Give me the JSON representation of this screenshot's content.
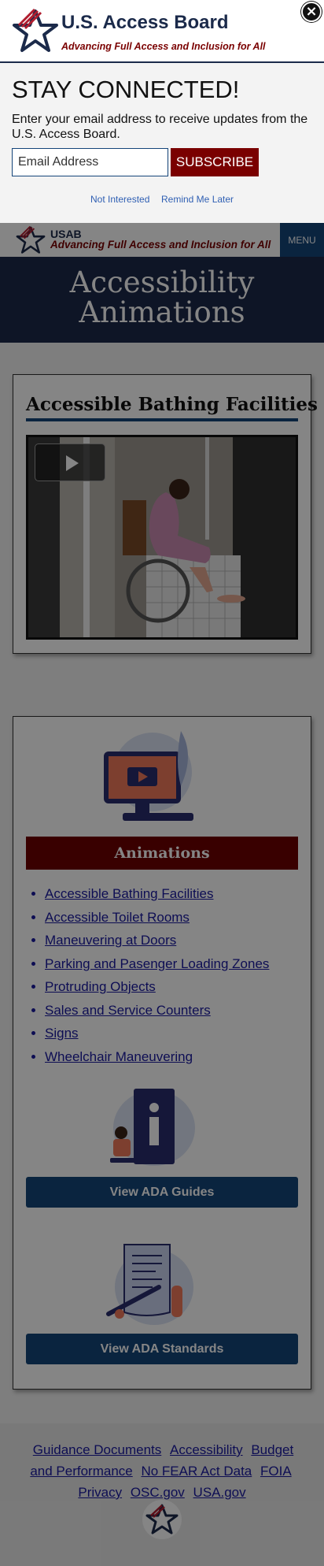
{
  "modal": {
    "org_name": "U.S. Access Board",
    "tagline": "Advancing Full Access and Inclusion for All",
    "heading": "STAY CONNECTED!",
    "description": "Enter your email address to receive updates from the U.S. Access Board.",
    "email_placeholder": "Email Address",
    "subscribe_label": "SUBSCRIBE",
    "not_interested_label": "Not Interested",
    "remind_later_label": "Remind Me Later",
    "close_icon": "close-icon"
  },
  "header": {
    "short_name": "USAB",
    "tagline": "Advancing Full Access and Inclusion for All",
    "menu_label": "MENU"
  },
  "hero": {
    "title": "Accessibility Animations"
  },
  "featured": {
    "title": "Accessible Bathing Facilities",
    "play_icon": "play-icon"
  },
  "animations": {
    "heading": "Animations",
    "items": [
      "Accessible Bathing Facilities",
      "Accessible Toilet Rooms",
      "Maneuvering at Doors",
      "Parking and Pasenger Loading Zones",
      "Protruding Objects",
      "Sales and Service Counters",
      "Signs",
      "Wheelchair Maneuvering"
    ],
    "guides_label": "View ADA Guides",
    "standards_label": "View ADA Standards"
  },
  "footer": {
    "links": [
      "Guidance Documents",
      "Accessibility",
      "Budget and Performance",
      "No FEAR Act Data",
      "FOIA",
      "Privacy",
      "OSC.gov",
      "USA.gov"
    ]
  },
  "colors": {
    "navy": "#1b2a4a",
    "blue": "#15457a",
    "maroon": "#7a0000"
  }
}
